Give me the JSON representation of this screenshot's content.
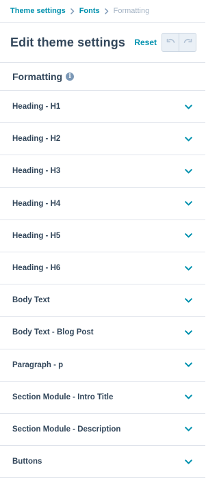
{
  "breadcrumb": {
    "items": [
      "Theme settings",
      "Fonts"
    ],
    "current": "Formatting"
  },
  "header": {
    "title": "Edit theme settings",
    "reset_label": "Reset"
  },
  "section": {
    "title": "Formatting"
  },
  "rows": [
    {
      "label": "Heading - H1"
    },
    {
      "label": "Heading - H2"
    },
    {
      "label": "Heading - H3"
    },
    {
      "label": "Heading - H4"
    },
    {
      "label": "Heading - H5"
    },
    {
      "label": "Heading - H6"
    },
    {
      "label": "Body Text"
    },
    {
      "label": "Body Text - Blog Post"
    },
    {
      "label": "Paragraph - p"
    },
    {
      "label": "Section Module - Intro Title"
    },
    {
      "label": "Section Module - Description"
    },
    {
      "label": "Buttons"
    }
  ],
  "colors": {
    "accent": "#0091ae",
    "text": "#33475b",
    "muted": "#a5b4c5",
    "border": "#dfe3eb"
  },
  "icons": {
    "breadcrumb_separator": "chevron-right-icon",
    "info": "info-icon",
    "undo": "undo-icon",
    "redo": "redo-icon",
    "row_expand": "chevron-down-icon"
  }
}
